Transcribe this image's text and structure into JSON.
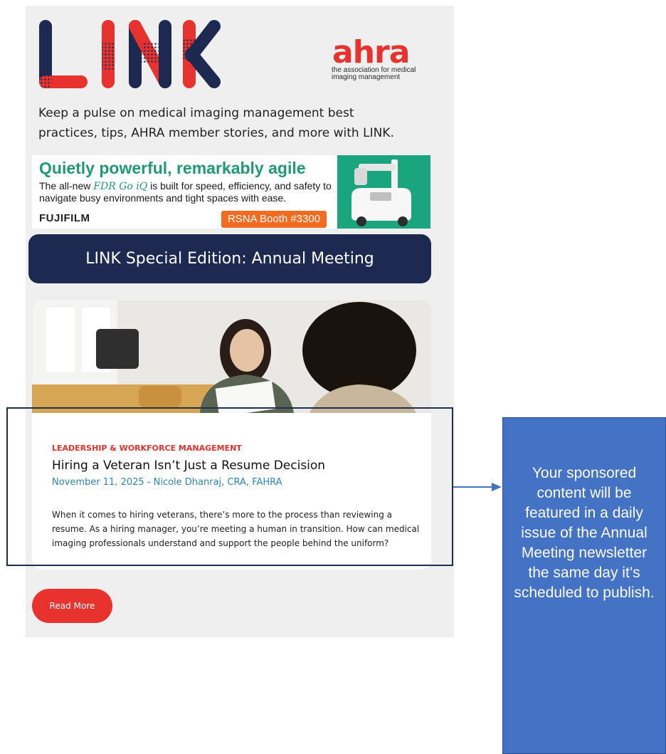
{
  "header": {
    "logo_text": "LINK",
    "ahra_wordmark": "ahra",
    "ahra_tagline": "the association for medical imaging management",
    "intro": "Keep a pulse on medical imaging management best practices, tips, AHRA member stories, and more with LINK."
  },
  "ad": {
    "headline": "Quietly powerful, remarkably agile",
    "body_before": "The all-new ",
    "product": "FDR Go iQ",
    "body_after": " is built for speed, efficiency, and safety to navigate busy environments and tight spaces with ease.",
    "brand": "FUJIFILM",
    "booth": "RSNA Booth #3300"
  },
  "edition": {
    "title": "LINK Special Edition: Annual Meeting"
  },
  "article": {
    "category": "LEADERSHIP & WORKFORCE MANAGEMENT",
    "title": "Hiring a Veteran Isn’t Just a Resume Decision",
    "meta": "November 11, 2025 - Nicole Dhanraj, CRA, FAHRA",
    "summary": "When it comes to hiring veterans, there’s more to the process than reviewing a resume. As a hiring manager, you’re meeting a human in transition. How can medical imaging professionals understand and support the people behind the uniform?"
  },
  "cta": {
    "read_more": "Read More"
  },
  "callout": {
    "text": "Your sponsored content will be featured in a daily issue of the Annual Meeting newsletter the same day it’s scheduled to publish."
  },
  "colors": {
    "navy": "#1d2951",
    "red": "#e8322d",
    "green": "#1f9a74",
    "orange": "#f36b21",
    "meta_blue": "#2b86b8",
    "callout_blue": "#4472c4"
  }
}
